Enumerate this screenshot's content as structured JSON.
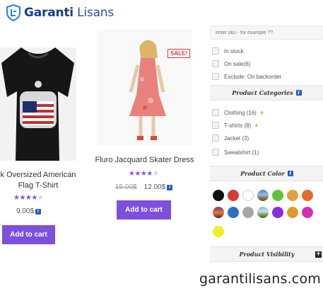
{
  "brand": {
    "logo_word_1": "Garanti",
    "logo_word_2": " Lisans"
  },
  "products": [
    {
      "title_line1": "k Oversized American",
      "title_line2": "Flag T-Shirt",
      "rating": 4,
      "price": "9.00$",
      "add_to_cart": "Add to cart"
    },
    {
      "title_line1": "Fluro Jacquard Skater Dress",
      "rating": 4,
      "old_price": "15.00$",
      "price": "12.00$",
      "sale_badge": "SALE!",
      "add_to_cart": "Add to cart"
    }
  ],
  "filters": {
    "sku_placeholder": "enter sku - for example ??",
    "checkboxes": [
      "In stock",
      "On sale(6)",
      "Exclude: On backorder"
    ],
    "categories_title": "Product Categories",
    "categories": [
      {
        "label": "Clothing (16)",
        "expandable": true
      },
      {
        "label": "T-shirts (8)",
        "expandable": true
      },
      {
        "label": "Jacket (3)",
        "expandable": false
      },
      {
        "label": "Sweatshirt (1)",
        "expandable": false
      }
    ],
    "color_title": "Product Color",
    "colors": [
      "#111111",
      "#d83a32",
      "#ffffff",
      "landscape-1",
      "#5ec43b",
      "#e0a23a",
      "#e26a2a",
      "sunset-1",
      "#2c6fc7",
      "#a7a7a7",
      "landscape-2",
      "#8a2be2",
      "#e09a2a",
      "#d52fb8",
      "#eef02a"
    ],
    "visibility_title": "Product Visibility"
  },
  "watermark": "garantilisans.com"
}
